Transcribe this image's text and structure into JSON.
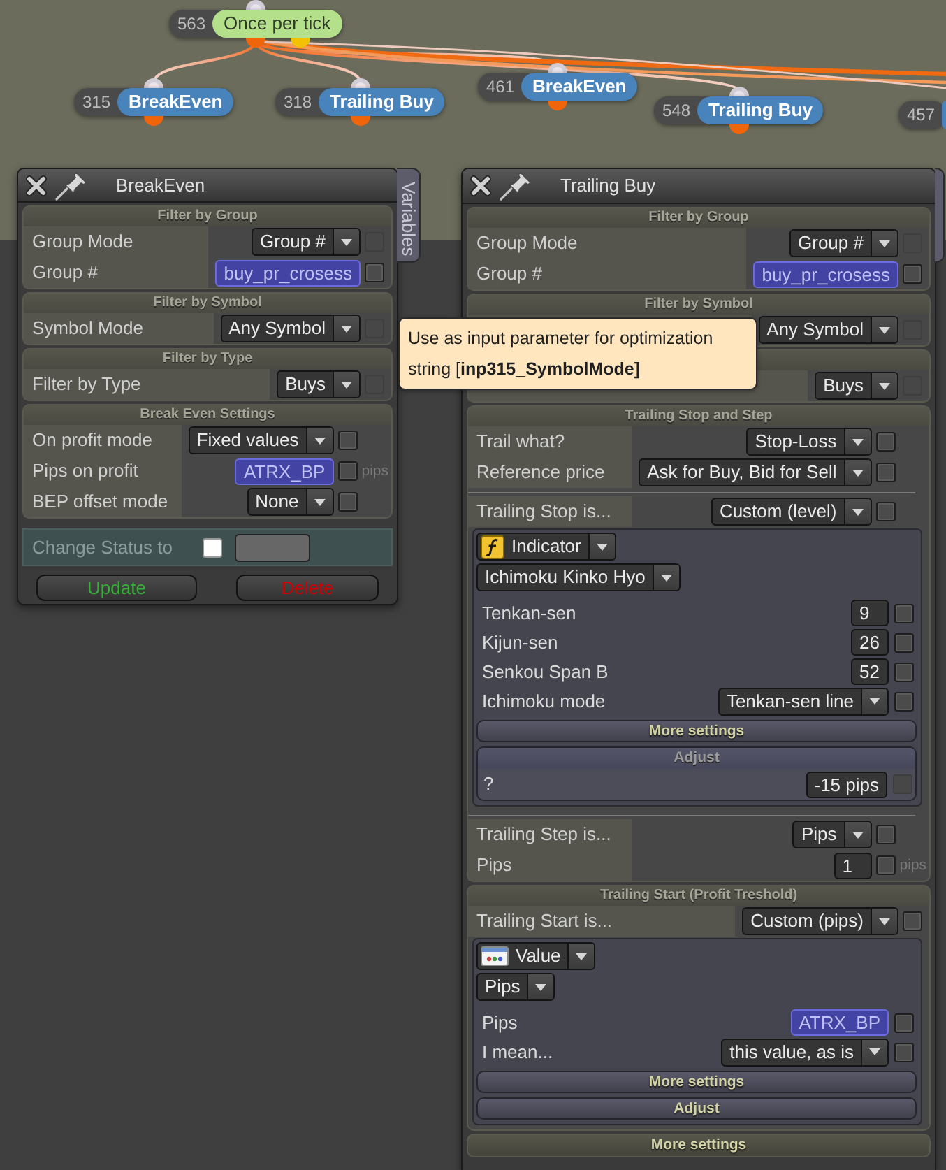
{
  "canvas": {
    "nodes": [
      {
        "number": "563",
        "title": "Once per tick",
        "kind": "trigger",
        "children": [
          {
            "number": "315",
            "title": "BreakEven",
            "kind": "action"
          },
          {
            "number": "318",
            "title": "Trailing Buy",
            "kind": "action"
          },
          {
            "number": "461",
            "title": "BreakEven",
            "kind": "action"
          },
          {
            "number": "548",
            "title": "Trailing Buy",
            "kind": "action"
          }
        ]
      },
      {
        "number": "457",
        "kind": "action"
      }
    ]
  },
  "panels": [
    {
      "title": "BreakEven",
      "side_tab": "Variables",
      "sections": [
        {
          "title": "Filter by Group",
          "expanded": true,
          "rows": [
            {
              "kind": "dropdown",
              "label": "Group Mode",
              "value": "Group #",
              "checkbox": {
                "checked": false,
                "disabled": true
              }
            },
            {
              "kind": "variable",
              "label": "Group #",
              "value": "buy_pr_crosess",
              "checkbox": {
                "checked": false,
                "disabled": false
              }
            }
          ]
        },
        {
          "title": "Filter by Symbol",
          "expanded": true,
          "rows": [
            {
              "kind": "dropdown",
              "label": "Symbol Mode",
              "value": "Any Symbol",
              "checkbox": {
                "checked": false,
                "disabled": true
              }
            }
          ]
        },
        {
          "title": "Filter by Type",
          "expanded": true,
          "rows": [
            {
              "kind": "dropdown",
              "label": "Filter by Type",
              "value": "Buys",
              "checkbox": {
                "checked": false,
                "disabled": true
              }
            }
          ]
        },
        {
          "title": "Break Even Settings",
          "expanded": true,
          "rows": [
            {
              "kind": "dropdown",
              "label": "On profit mode",
              "value": "Fixed values",
              "checkbox": {
                "checked": false,
                "disabled": false
              }
            },
            {
              "kind": "variable",
              "label": "Pips on profit",
              "value": "ATRX_BP",
              "checkbox": {
                "checked": false,
                "disabled": false
              },
              "unit": "pips"
            },
            {
              "kind": "dropdown",
              "label": "BEP offset mode",
              "value": "None",
              "checkbox": {
                "checked": false,
                "disabled": false
              }
            }
          ]
        }
      ],
      "status_row": {
        "label": "Change Status to",
        "checked": false
      },
      "buttons": [
        {
          "label": "Update",
          "kind": "update"
        },
        {
          "label": "Delete",
          "kind": "delete"
        }
      ]
    },
    {
      "title": "Trailing Buy",
      "sections": [
        {
          "title": "Filter by Group",
          "expanded": true,
          "rows": [
            {
              "kind": "dropdown",
              "label": "Group Mode",
              "value": "Group #",
              "checkbox": {
                "checked": false,
                "disabled": true
              }
            },
            {
              "kind": "variable",
              "label": "Group #",
              "value": "buy_pr_crosess",
              "checkbox": {
                "checked": false,
                "disabled": false
              }
            }
          ]
        },
        {
          "title": "Filter by Symbol",
          "expanded": true,
          "rows": [
            {
              "kind": "dropdown",
              "value": "Any Symbol",
              "checkbox": {
                "checked": false,
                "disabled": true
              }
            }
          ]
        },
        {
          "expanded": true,
          "rows": [
            {
              "kind": "dropdown",
              "value": "Buys",
              "checkbox": {
                "checked": false,
                "disabled": true
              }
            }
          ]
        },
        {
          "title": "Trailing Stop and Step",
          "expanded": true,
          "rows": [
            {
              "kind": "dropdown",
              "label": "Trail what?",
              "value": "Stop-Loss",
              "checkbox": {
                "checked": false,
                "disabled": false
              }
            },
            {
              "kind": "dropdown",
              "label": "Reference price",
              "value": "Ask for Buy, Bid for Sell",
              "checkbox": {
                "checked": false,
                "disabled": false
              }
            },
            {
              "kind": "divider"
            },
            {
              "kind": "dropdown",
              "label": "Trailing Stop is...",
              "value": "Custom (level)",
              "checkbox": {
                "checked": false,
                "disabled": false
              }
            },
            {
              "kind": "block",
              "source": {
                "kind": "function",
                "label": "Indicator"
              },
              "choice": "Ichimoku Kinko Hyo",
              "rows": [
                {
                  "kind": "number",
                  "label": "Tenkan-sen",
                  "value": "9",
                  "checkbox": {
                    "checked": false,
                    "disabled": false
                  }
                },
                {
                  "kind": "number",
                  "label": "Kijun-sen",
                  "value": "26",
                  "checkbox": {
                    "checked": false,
                    "disabled": false
                  }
                },
                {
                  "kind": "number",
                  "label": "Senkou Span B",
                  "value": "52",
                  "checkbox": {
                    "checked": false,
                    "disabled": false
                  }
                },
                {
                  "kind": "dropdown",
                  "label": "Ichimoku mode",
                  "value": "Tenkan-sen line",
                  "checkbox": {
                    "checked": false,
                    "disabled": false
                  }
                }
              ],
              "bars": [
                {
                  "title": "More settings",
                  "expanded": false
                },
                {
                  "title": "Adjust",
                  "expanded": true,
                  "rows": [
                    {
                      "kind": "number",
                      "label": "?",
                      "value": "-15 pips",
                      "checkbox": {
                        "checked": false,
                        "disabled": true
                      }
                    }
                  ]
                }
              ]
            },
            {
              "kind": "divider"
            },
            {
              "kind": "dropdown",
              "label": "Trailing Step is...",
              "value": "Pips",
              "checkbox": {
                "checked": false,
                "disabled": false
              }
            },
            {
              "kind": "number",
              "label": "Pips",
              "value": "1",
              "checkbox": {
                "checked": false,
                "disabled": false
              },
              "unit": "pips"
            }
          ]
        },
        {
          "title": "Trailing Start (Profit Treshold)",
          "expanded": true,
          "rows": [
            {
              "kind": "dropdown",
              "label": "Trailing Start is...",
              "value": "Custom (pips)",
              "checkbox": {
                "checked": false,
                "disabled": false
              }
            },
            {
              "kind": "block",
              "source": {
                "kind": "value",
                "label": "Value"
              },
              "choice": "Pips",
              "rows": [
                {
                  "kind": "variable",
                  "label": "Pips",
                  "value": "ATRX_BP",
                  "checkbox": {
                    "checked": false,
                    "disabled": false
                  }
                },
                {
                  "kind": "dropdown",
                  "label": "I mean...",
                  "value": "this value, as is",
                  "checkbox": {
                    "checked": false,
                    "disabled": false
                  }
                }
              ],
              "bars": [
                {
                  "title": "More settings",
                  "expanded": false
                },
                {
                  "title": "Adjust",
                  "expanded": false
                }
              ]
            }
          ]
        },
        {
          "title": "More settings",
          "expanded": false
        }
      ]
    }
  ],
  "tooltip": {
    "text": "Use as input parameter for optimization string [**inp315_SymbolMode]**"
  }
}
